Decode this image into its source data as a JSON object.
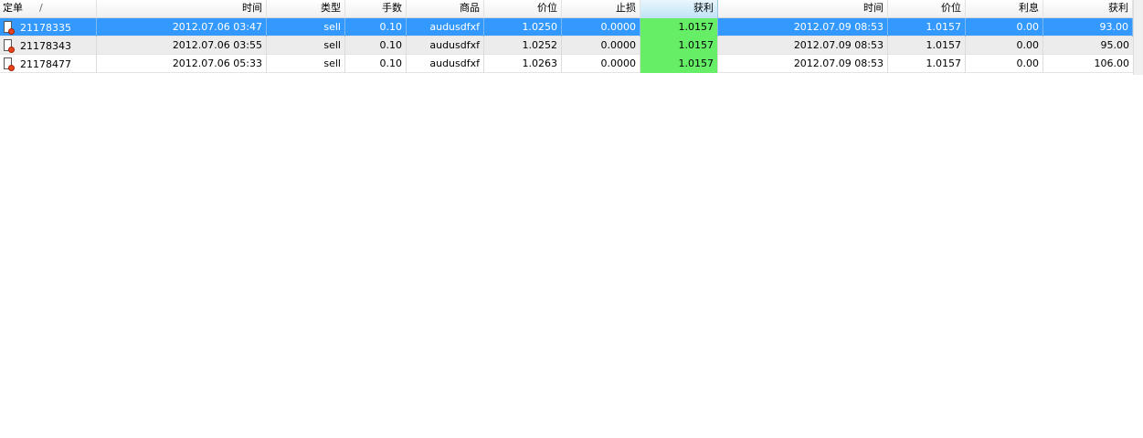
{
  "header": {
    "columns": [
      "定单",
      "时间",
      "类型",
      "手数",
      "商品",
      "价位",
      "止损",
      "获利",
      "时间",
      "价位",
      "利息",
      "获利"
    ],
    "sort_indicator": "/"
  },
  "rows": [
    {
      "order": "21178335",
      "open_time": "2012.07.06 03:47",
      "type": "sell",
      "lots": "0.10",
      "symbol": "audusdfxf",
      "open_price": "1.0250",
      "stop_loss": "0.0000",
      "take_profit": "1.0157",
      "close_time": "2012.07.09 08:53",
      "close_price": "1.0157",
      "swap": "0.00",
      "profit": "93.00"
    },
    {
      "order": "21178343",
      "open_time": "2012.07.06 03:55",
      "type": "sell",
      "lots": "0.10",
      "symbol": "audusdfxf",
      "open_price": "1.0252",
      "stop_loss": "0.0000",
      "take_profit": "1.0157",
      "close_time": "2012.07.09 08:53",
      "close_price": "1.0157",
      "swap": "0.00",
      "profit": "95.00"
    },
    {
      "order": "21178477",
      "open_time": "2012.07.06 05:33",
      "type": "sell",
      "lots": "0.10",
      "symbol": "audusdfxf",
      "open_price": "1.0263",
      "stop_loss": "0.0000",
      "take_profit": "1.0157",
      "close_time": "2012.07.09 08:53",
      "close_price": "1.0157",
      "swap": "0.00",
      "profit": "106.00"
    }
  ],
  "colors": {
    "selection": "#3399ff",
    "take_profit_highlight": "#66ee66",
    "order_icon_dot": "#e8451e"
  },
  "icons": {
    "order_icon": "document-with-red-dot-icon"
  }
}
